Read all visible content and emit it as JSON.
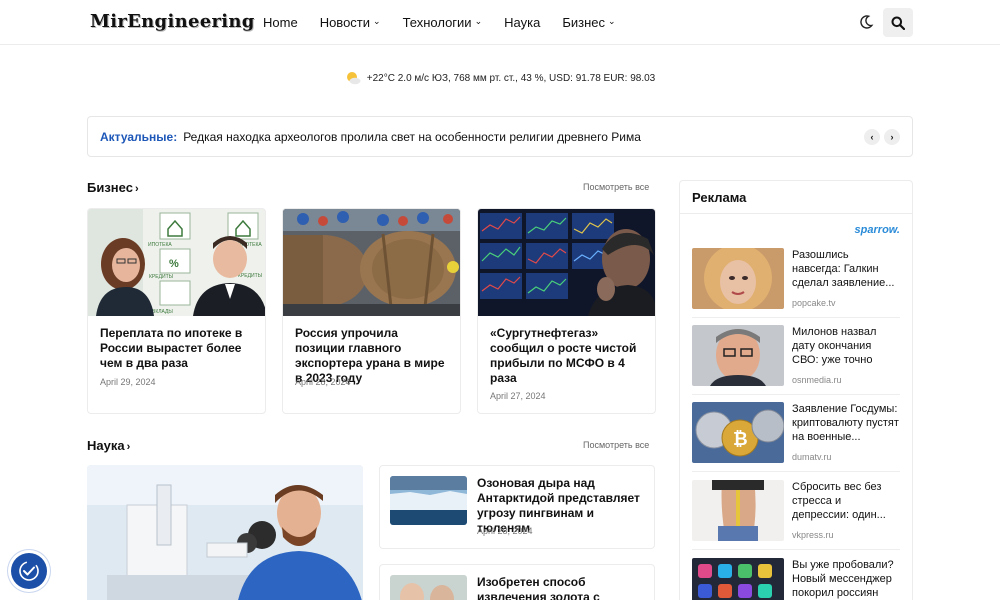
{
  "header": {
    "logo": "MirEngineering",
    "nav": [
      {
        "label": "Home",
        "dropdown": false
      },
      {
        "label": "Новости",
        "dropdown": true
      },
      {
        "label": "Технологии",
        "dropdown": true
      },
      {
        "label": "Наука",
        "dropdown": false
      },
      {
        "label": "Бизнес",
        "dropdown": true
      }
    ],
    "icons": {
      "theme_toggle": "moon-icon",
      "search": "search-icon"
    }
  },
  "weather": {
    "icon": "partly-sunny-icon",
    "text": "+22°C  2.0 м/с ЮЗ,  768 мм рт. ст.,  43 %,   USD: 91.78  EUR: 98.03"
  },
  "ticker": {
    "label": "Актуальные:",
    "text": "Редкая находка археологов пролила свет на особенности религии древнего Рима"
  },
  "business": {
    "heading": "Бизнес",
    "see_all": "Посмотреть все",
    "cards": [
      {
        "title": "Переплата по ипотеке в России вырастет более чем в два раза",
        "date": "April 29, 2024"
      },
      {
        "title": "Россия упрочила позиции главного экспортера урана в мире в 2023 году",
        "date": "April 28, 2024"
      },
      {
        "title": "«Сургутнефтегаз» сообщил о росте чистой прибыли по МСФО в 4 раза",
        "date": "April 27, 2024"
      }
    ],
    "image_labels": {
      "ipoteka": "ИПОТЕКА",
      "kredity": "КРЕДИТЫ",
      "vklady": "ВКЛАДЫ"
    }
  },
  "science": {
    "heading": "Наука",
    "see_all": "Посмотреть все",
    "cards": [
      {
        "title": "Озоновая дыра над Антарктидой представляет угрозу пингвинам и тюленям",
        "date": "April 28, 2024"
      },
      {
        "title": "Изобретен способ извлечения золота с",
        "date": ""
      }
    ]
  },
  "ads": {
    "heading": "Реклама",
    "brand": "sparrow.",
    "items": [
      {
        "text": "Разошлись навсегда: Галкин сделал заявление...",
        "source": "popcake.tv"
      },
      {
        "text": "Милонов назвал дату окончания СВО: уже точно",
        "source": "osnmedia.ru"
      },
      {
        "text": "Заявление Госдумы: криптовалюту пустят на военные...",
        "source": "dumatv.ru"
      },
      {
        "text": "Сбросить вес без стресса и депрессии: один...",
        "source": "vkpress.ru"
      },
      {
        "text": "Вы уже пробовали? Новый мессенджер покорил россиян",
        "source": ""
      }
    ]
  },
  "colors": {
    "accent": "#1d57b8",
    "ad_brand": "#2a8bd8",
    "a11y_button": "#1c4fa8"
  }
}
